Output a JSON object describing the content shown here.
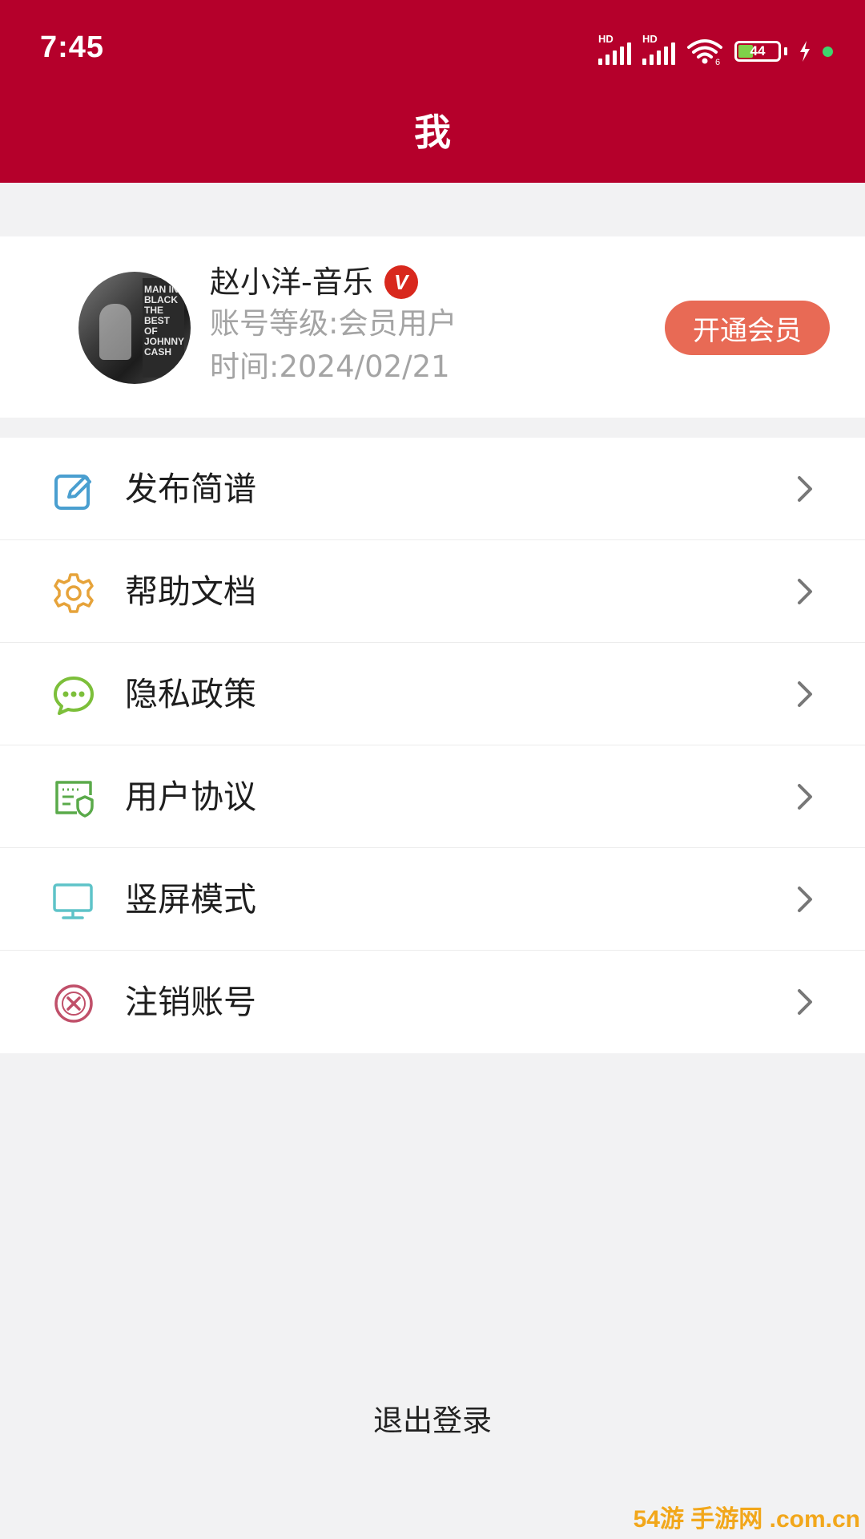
{
  "status_bar": {
    "time": "7:45",
    "battery": "44",
    "network_label_1": "HD",
    "network_label_2": "HD",
    "wifi_label": "6"
  },
  "header": {
    "title": "我"
  },
  "profile": {
    "name": "赵小洋-音乐",
    "verified_badge": "V",
    "level": "账号等级:会员用户",
    "time": "时间:2024/02/21",
    "vip_button": "开通会员",
    "avatar_cover_text": "MAN IN BLACK THE BEST OF JOHNNY CASH"
  },
  "menu": {
    "items": [
      {
        "label": "发布简谱",
        "icon": "edit-icon",
        "color": "#4a9fd0"
      },
      {
        "label": "帮助文档",
        "icon": "gear-icon",
        "color": "#e6a33a"
      },
      {
        "label": "隐私政策",
        "icon": "chat-bubble-icon",
        "color": "#7cbf3a"
      },
      {
        "label": "用户协议",
        "icon": "agreement-shield-icon",
        "color": "#5aaa4a"
      },
      {
        "label": "竖屏模式",
        "icon": "monitor-icon",
        "color": "#5ec3c8"
      },
      {
        "label": "注销账号",
        "icon": "cancel-circle-icon",
        "color": "#c0506a"
      }
    ]
  },
  "logout": {
    "label": "退出登录"
  },
  "watermark": {
    "text": "54游 手游网 .com.cn"
  },
  "colors": {
    "header_bg": "#b5002b",
    "vip_button": "#e86a55",
    "background": "#f2f2f3"
  }
}
